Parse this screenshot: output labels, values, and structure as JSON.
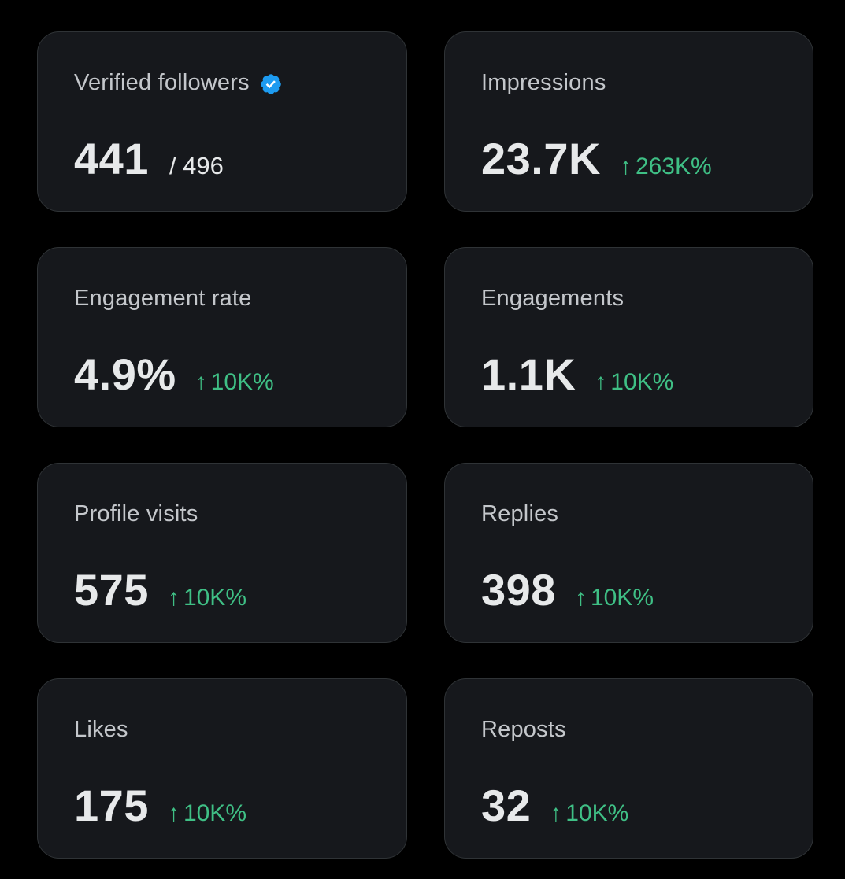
{
  "colors": {
    "background": "#000000",
    "card": "#16181c",
    "card_border": "#2f3336",
    "label": "#c4c7cb",
    "value": "#e7e9ea",
    "positive": "#3fbf85",
    "verified_badge": "#1d9bf0"
  },
  "cards": [
    {
      "label": "Verified followers",
      "value": "441",
      "total": "/ 496",
      "verified_icon": "verified-badge-icon"
    },
    {
      "label": "Impressions",
      "value": "23.7K",
      "change": "263K%",
      "change_icon": "arrow-up-icon"
    },
    {
      "label": "Engagement rate",
      "value": "4.9%",
      "change": "10K%",
      "change_icon": "arrow-up-icon"
    },
    {
      "label": "Engagements",
      "value": "1.1K",
      "change": "10K%",
      "change_icon": "arrow-up-icon"
    },
    {
      "label": "Profile visits",
      "value": "575",
      "change": "10K%",
      "change_icon": "arrow-up-icon"
    },
    {
      "label": "Replies",
      "value": "398",
      "change": "10K%",
      "change_icon": "arrow-up-icon"
    },
    {
      "label": "Likes",
      "value": "175",
      "change": "10K%",
      "change_icon": "arrow-up-icon"
    },
    {
      "label": "Reposts",
      "value": "32",
      "change": "10K%",
      "change_icon": "arrow-up-icon"
    }
  ]
}
